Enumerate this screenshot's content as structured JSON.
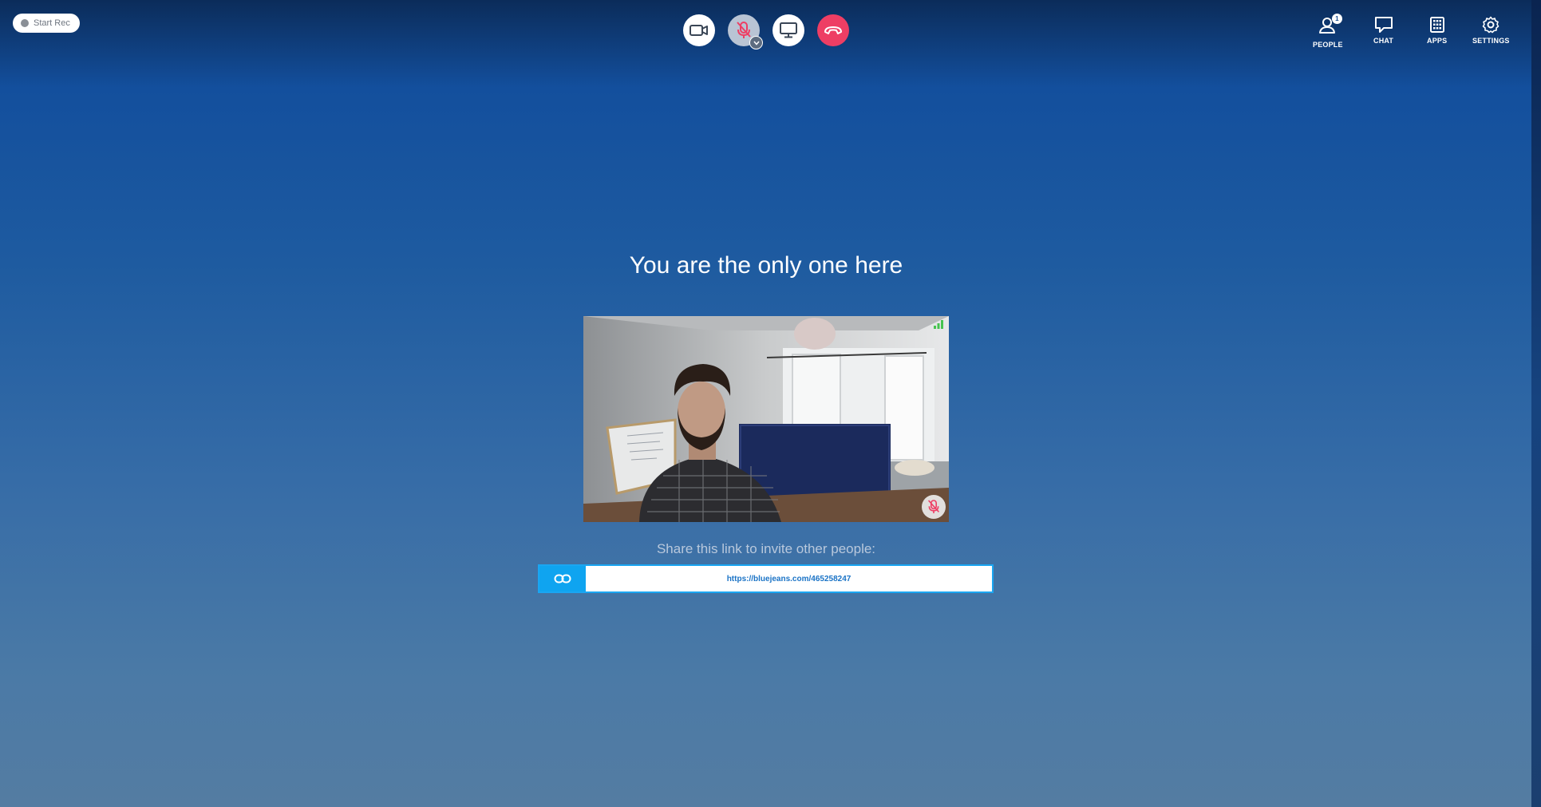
{
  "recording": {
    "label": "Start Rec"
  },
  "controls": {
    "camera_icon": "video-camera-icon",
    "mic_icon": "microphone-muted-icon",
    "share_icon": "screen-share-icon",
    "hangup_icon": "hang-up-icon",
    "hangup_color": "#ee3e64"
  },
  "nav": {
    "people": {
      "label": "PEOPLE",
      "count": "1"
    },
    "chat": {
      "label": "CHAT"
    },
    "apps": {
      "label": "APPS"
    },
    "settings": {
      "label": "SETTINGS"
    }
  },
  "main": {
    "headline": "You are the only one here",
    "share_prompt": "Share this link to invite other people:",
    "invite_url": "https://bluejeans.com/465258247"
  },
  "colors": {
    "accent": "#0fa4f0",
    "link_text": "#1a73c6"
  }
}
